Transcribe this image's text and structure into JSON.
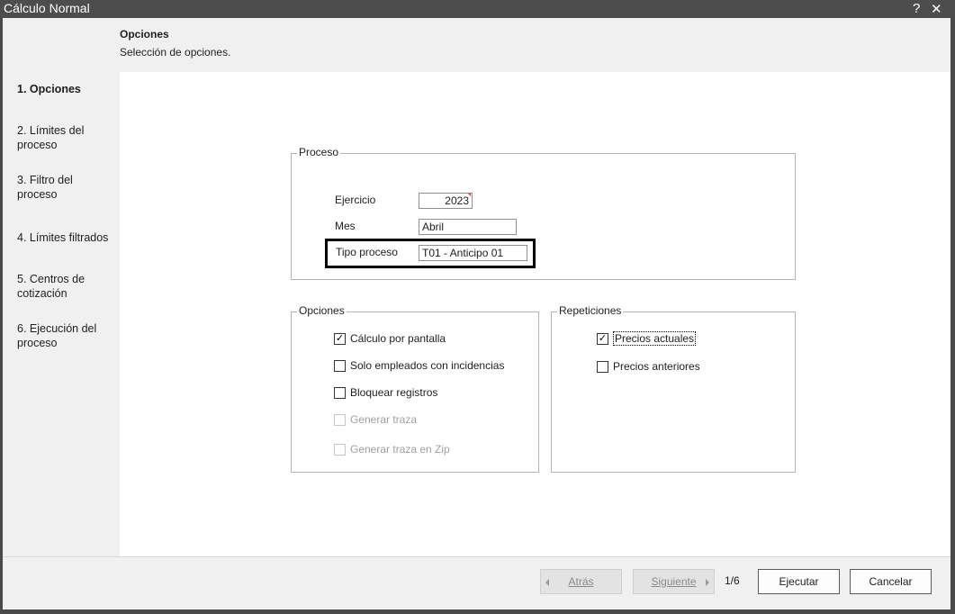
{
  "window": {
    "title": "Cálculo Normal",
    "help_glyph": "?",
    "close_glyph": "✕"
  },
  "header": {
    "title": "Opciones",
    "subtitle": "Selección de opciones."
  },
  "steps": [
    {
      "label": "1. Opciones",
      "active": true
    },
    {
      "label": "2. Límites del proceso"
    },
    {
      "label": "3. Filtro del proceso"
    },
    {
      "label": "4. Límites filtrados"
    },
    {
      "label": "5. Centros de cotización"
    },
    {
      "label": "6. Ejecución del proceso"
    }
  ],
  "proceso": {
    "legend": "Proceso",
    "ejercicio": {
      "label": "Ejercicio",
      "value": "2023"
    },
    "mes": {
      "label": "Mes",
      "value": "Abril"
    },
    "tipo": {
      "label": "Tipo proceso",
      "value": "T01 - Anticipo 01"
    }
  },
  "opciones": {
    "legend": "Opciones",
    "items": [
      {
        "label": "Cálculo por pantalla",
        "checked": true,
        "enabled": true
      },
      {
        "label": "Solo empleados con incidencias",
        "checked": false,
        "enabled": true
      },
      {
        "label": "Bloquear registros",
        "checked": false,
        "enabled": true
      },
      {
        "label": "Generar traza",
        "checked": false,
        "enabled": false
      },
      {
        "label": "Generar traza en Zip",
        "checked": false,
        "enabled": false
      }
    ]
  },
  "repeticiones": {
    "legend": "Repeticiones",
    "items": [
      {
        "label": "Precios actuales",
        "checked": true,
        "enabled": true
      },
      {
        "label": "Precios anteriores",
        "checked": false,
        "enabled": true
      }
    ]
  },
  "footer": {
    "back_label": "Atrás",
    "next_label": "Siguiente",
    "pager": "1/6",
    "execute_label": "Ejecutar",
    "cancel_label": "Cancelar"
  },
  "check_glyph": "✓"
}
